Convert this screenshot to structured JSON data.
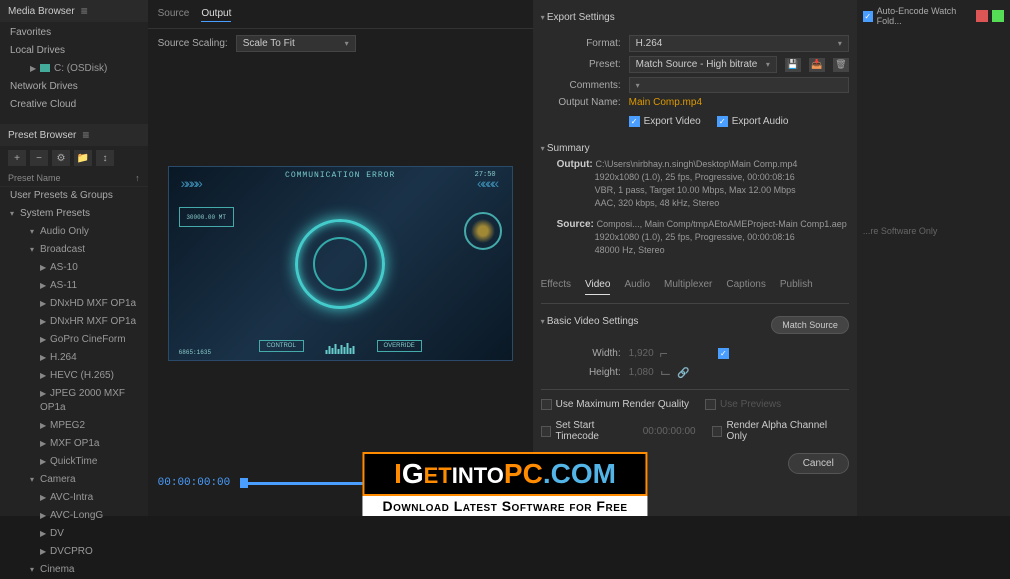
{
  "leftPanel": {
    "mediaBrowserTitle": "Media Browser",
    "favorites": "Favorites",
    "localDrives": "Local Drives",
    "cDrive": "C: (OSDisk)",
    "networkDrives": "Network Drives",
    "creativeCloud": "Creative Cloud",
    "presetBrowserTitle": "Preset Browser",
    "presetNameLabel": "Preset Name",
    "userPresetsGroups": "User Presets & Groups",
    "systemPresets": "System Presets",
    "presets": [
      "Audio Only",
      "Broadcast",
      "AS-10",
      "AS-11",
      "DNxHD MXF OP1a",
      "DNxHR MXF OP1a",
      "GoPro CineForm",
      "H.264",
      "HEVC (H.265)",
      "JPEG 2000 MXF OP1a",
      "MPEG2",
      "MXF OP1a",
      "QuickTime",
      "Camera",
      "AVC-Intra",
      "AVC-LongG",
      "DV",
      "DVCPRO",
      "Cinema"
    ]
  },
  "center": {
    "tabSource": "Source",
    "tabOutput": "Output",
    "scalingLabel": "Source Scaling:",
    "scalingValue": "Scale To Fit",
    "hud": {
      "title": "COMMUNICATION ERROR",
      "time": "27:50",
      "boxLeft": "30000.00 MT",
      "bottomLeft": "6865:1635",
      "btnControl": "CONTROL",
      "btnOverride": "OVERRIDE"
    },
    "timecode": "00:00:00:00",
    "sourceLabel": "Sourc"
  },
  "export": {
    "header": "Export Settings",
    "formatLabel": "Format:",
    "formatValue": "H.264",
    "presetLabel": "Preset:",
    "presetValue": "Match Source - High bitrate",
    "commentsLabel": "Comments:",
    "outputNameLabel": "Output Name:",
    "outputNameValue": "Main Comp.mp4",
    "exportVideo": "Export Video",
    "exportAudio": "Export Audio",
    "summaryHeader": "Summary",
    "outputLabel": "Output:",
    "outputPath": "C:\\Users\\nirbhay.n.singh\\Desktop\\Main Comp.mp4",
    "outputDetails1": "1920x1080 (1.0), 25 fps, Progressive, 00:00:08:16",
    "outputDetails2": "VBR, 1 pass, Target 10.00 Mbps, Max 12.00 Mbps",
    "outputDetails3": "AAC, 320 kbps, 48 kHz, Stereo",
    "sourceLabel": "Source:",
    "sourceDetails1": "Composi..., Main Comp/tmpAEtoAMEProject-Main Comp1.aep",
    "sourceDetails2": "1920x1080 (1.0), 25 fps, Progressive, 00:00:08:16",
    "sourceDetails3": "48000 Hz, Stereo",
    "tabs": [
      "Effects",
      "Video",
      "Audio",
      "Multiplexer",
      "Captions",
      "Publish"
    ],
    "activeTab": "Video",
    "basicVideoHeader": "Basic Video Settings",
    "matchSourceBtn": "Match Source",
    "widthLabel": "Width:",
    "widthValue": "1,920",
    "heightLabel": "Height:",
    "heightValue": "1,080",
    "useMaxRender": "Use Maximum Render Quality",
    "usePreviews": "Use Previews",
    "setStartTimecode": "Set Start Timecode",
    "startTimecodeValue": "00:00:00:00",
    "renderAlpha": "Render Alpha Channel Only",
    "cancelBtn": "Cancel"
  },
  "queue": {
    "autoEncode": "Auto-Encode Watch Fold...",
    "rendererText": "...re Software Only"
  },
  "watermark": {
    "subtitle": "Download Latest Software for Free"
  }
}
